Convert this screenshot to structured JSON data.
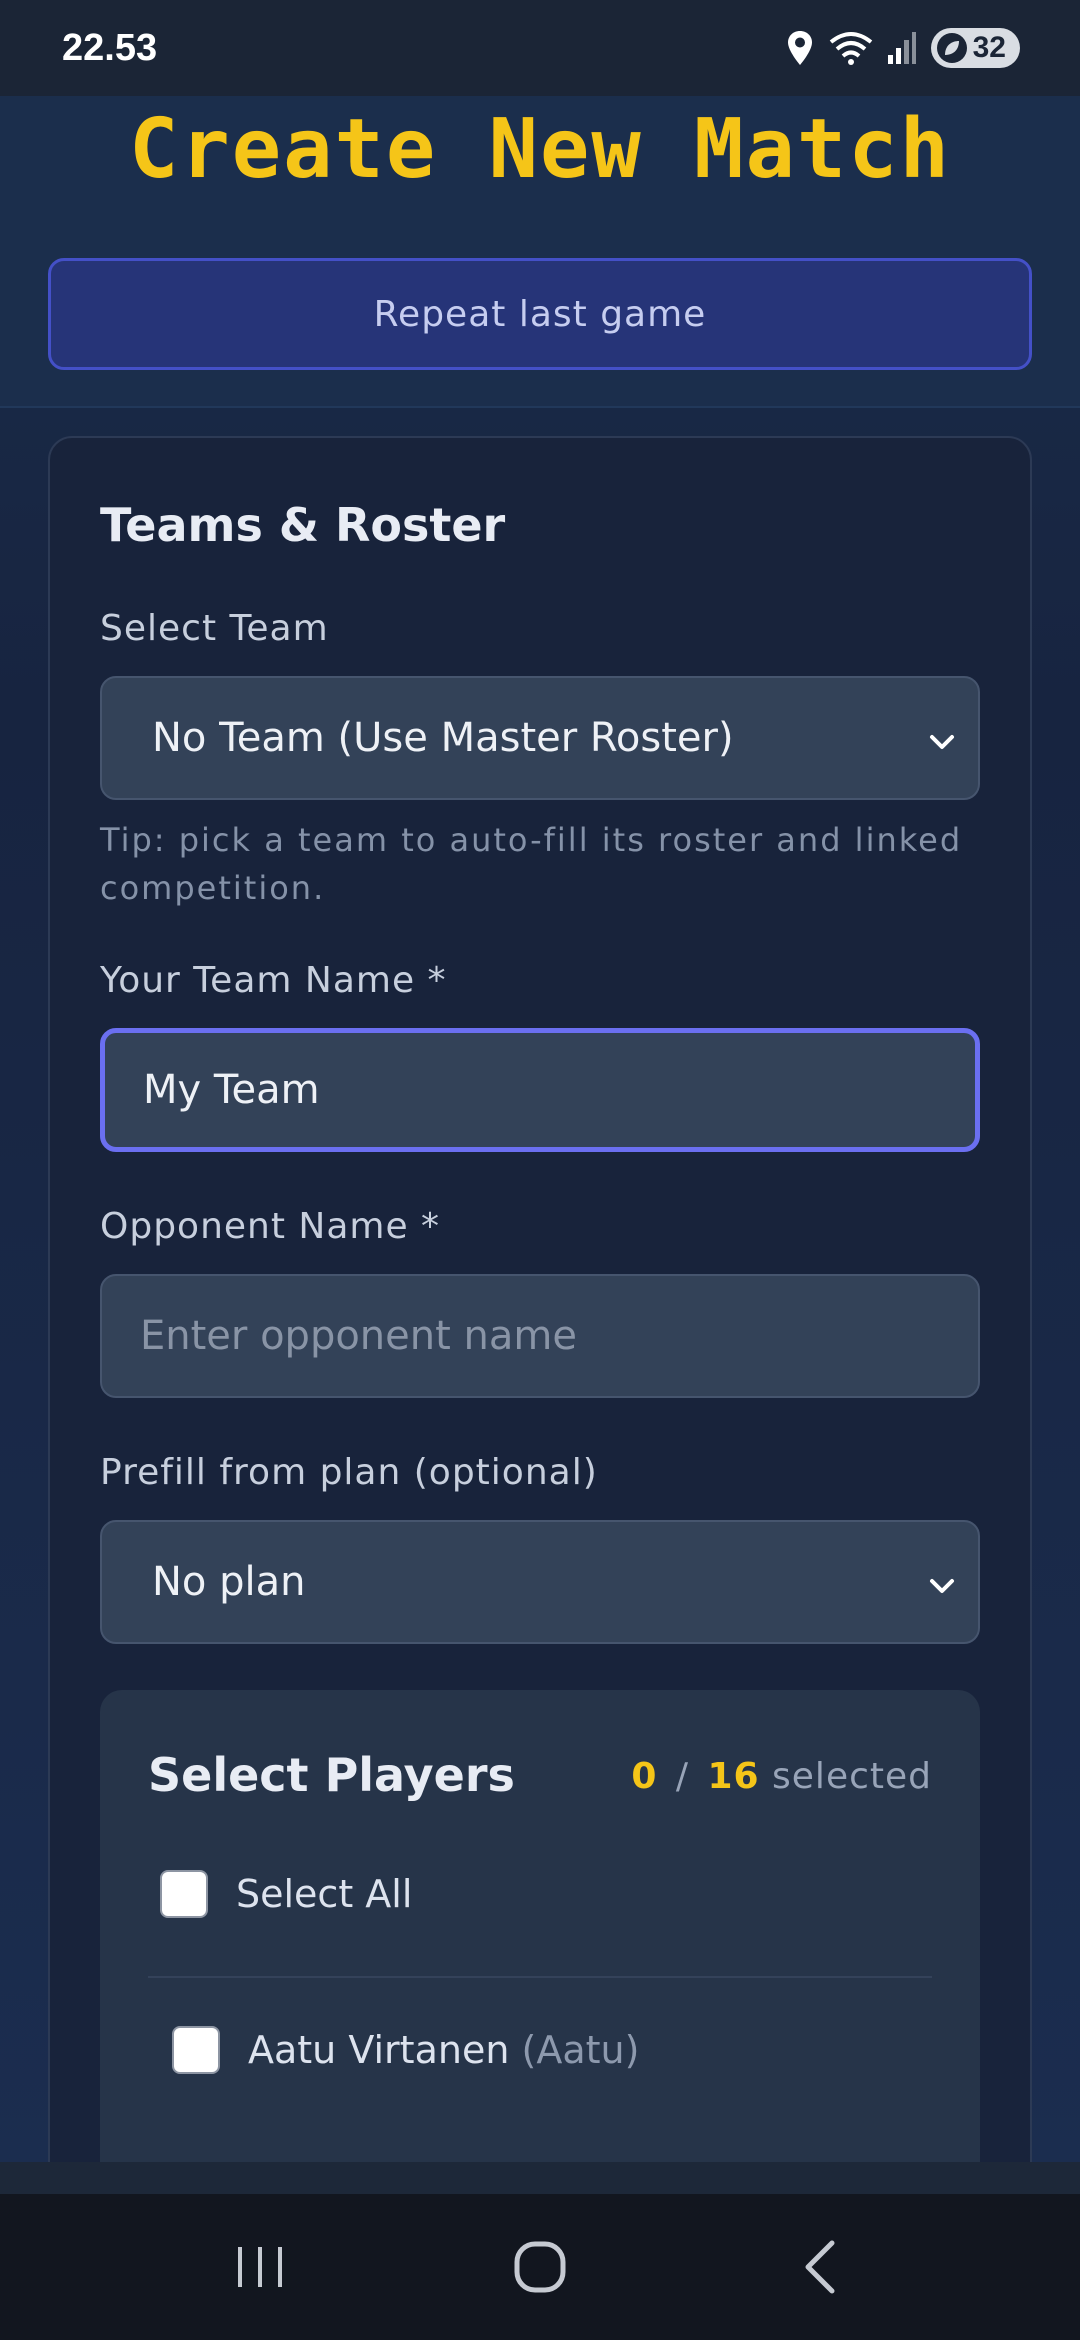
{
  "status_bar": {
    "time": "22.53",
    "battery_level": "32",
    "icons": [
      "location-icon",
      "wifi-icon",
      "signal-icon",
      "battery-icon"
    ]
  },
  "header": {
    "title": "Create New Match",
    "repeat_button": "Repeat last game"
  },
  "teams_roster": {
    "section_title": "Teams & Roster",
    "select_team": {
      "label": "Select Team",
      "value": "No Team (Use Master Roster)"
    },
    "tip": "Tip: pick a team to auto-fill its roster and linked competition.",
    "team_name": {
      "label": "Your Team Name *",
      "value": "My Team"
    },
    "opponent_name": {
      "label": "Opponent Name *",
      "placeholder": "Enter opponent name",
      "value": ""
    },
    "prefill_plan": {
      "label": "Prefill from plan (optional)",
      "value": "No plan"
    }
  },
  "players": {
    "title": "Select Players",
    "selected_count": "0",
    "separator": "/",
    "total_count": "16",
    "selected_suffix": "selected",
    "select_all_label": "Select All",
    "select_all_checked": false,
    "list": [
      {
        "name": "Aatu Virtanen",
        "nickname": "(Aatu)",
        "checked": false
      }
    ]
  },
  "colors": {
    "accent": "#f5c518",
    "focus": "#6b6ff0",
    "repeat_button_bg": "#263478",
    "background": "#1a2844"
  },
  "nav": {
    "icons": [
      "recent-apps-icon",
      "home-icon",
      "back-icon"
    ]
  }
}
